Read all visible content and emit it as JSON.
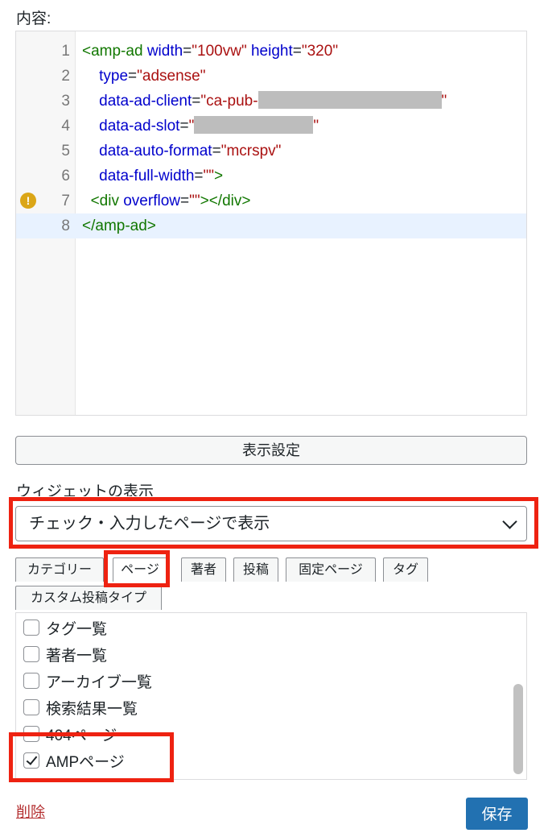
{
  "content_label": "内容:",
  "editor": {
    "lines": [
      {
        "num": "1",
        "tokens": [
          [
            "tag",
            "<amp-ad"
          ],
          [
            "plain",
            " "
          ],
          [
            "attr",
            "width"
          ],
          [
            "plain",
            "="
          ],
          [
            "str",
            "\"100vw\""
          ],
          [
            "plain",
            " "
          ],
          [
            "attr",
            "height"
          ],
          [
            "plain",
            "="
          ],
          [
            "str",
            "\"320\""
          ]
        ]
      },
      {
        "num": "2",
        "tokens": [
          [
            "plain",
            "    "
          ],
          [
            "attr",
            "type"
          ],
          [
            "plain",
            "="
          ],
          [
            "str",
            "\"adsense\""
          ]
        ]
      },
      {
        "num": "3",
        "tokens": [
          [
            "plain",
            "    "
          ],
          [
            "attr",
            "data-ad-client"
          ],
          [
            "plain",
            "="
          ],
          [
            "str",
            "\"ca-pub-"
          ],
          [
            "redact",
            "220"
          ],
          [
            "str",
            "\""
          ]
        ]
      },
      {
        "num": "4",
        "tokens": [
          [
            "plain",
            "    "
          ],
          [
            "attr",
            "data-ad-slot"
          ],
          [
            "plain",
            "="
          ],
          [
            "str",
            "\""
          ],
          [
            "redact",
            "145"
          ],
          [
            "str",
            "\""
          ]
        ]
      },
      {
        "num": "5",
        "tokens": [
          [
            "plain",
            "    "
          ],
          [
            "attr",
            "data-auto-format"
          ],
          [
            "plain",
            "="
          ],
          [
            "str",
            "\"mcrspv\""
          ]
        ]
      },
      {
        "num": "6",
        "tokens": [
          [
            "plain",
            "    "
          ],
          [
            "attr",
            "data-full-width"
          ],
          [
            "plain",
            "="
          ],
          [
            "str",
            "\"\""
          ],
          [
            "tag",
            ">"
          ]
        ]
      },
      {
        "num": "7",
        "warning": true,
        "tokens": [
          [
            "plain",
            "  "
          ],
          [
            "tag",
            "<div"
          ],
          [
            "plain",
            " "
          ],
          [
            "attr",
            "overflow"
          ],
          [
            "plain",
            "="
          ],
          [
            "str",
            "\"\""
          ],
          [
            "tag",
            "></div>"
          ]
        ]
      },
      {
        "num": "8",
        "active": true,
        "tokens": [
          [
            "tag",
            "</amp-ad>"
          ]
        ]
      }
    ]
  },
  "display_settings_button": "表示設定",
  "widget_display_label": "ウィジェットの表示",
  "display_select": {
    "selected": "チェック・入力したページで表示"
  },
  "tabs": [
    {
      "label": "カテゴリー"
    },
    {
      "label": "ページ"
    },
    {
      "label": "著者"
    },
    {
      "label": "投稿"
    },
    {
      "label": "固定ページ"
    },
    {
      "label": "タグ"
    },
    {
      "label": "カスタム投稿タイプ"
    }
  ],
  "checkbox_items": [
    {
      "label": "タグ一覧",
      "checked": false
    },
    {
      "label": "著者一覧",
      "checked": false
    },
    {
      "label": "アーカイブ一覧",
      "checked": false
    },
    {
      "label": "検索結果一覧",
      "checked": false
    },
    {
      "label": "404ページ",
      "checked": false
    },
    {
      "label": "AMPページ",
      "checked": true
    }
  ],
  "delete_link": "削除",
  "save_button": "保存",
  "colors": {
    "highlight": "#ee2211",
    "primary": "#2271b1",
    "warning": "#dba617"
  }
}
